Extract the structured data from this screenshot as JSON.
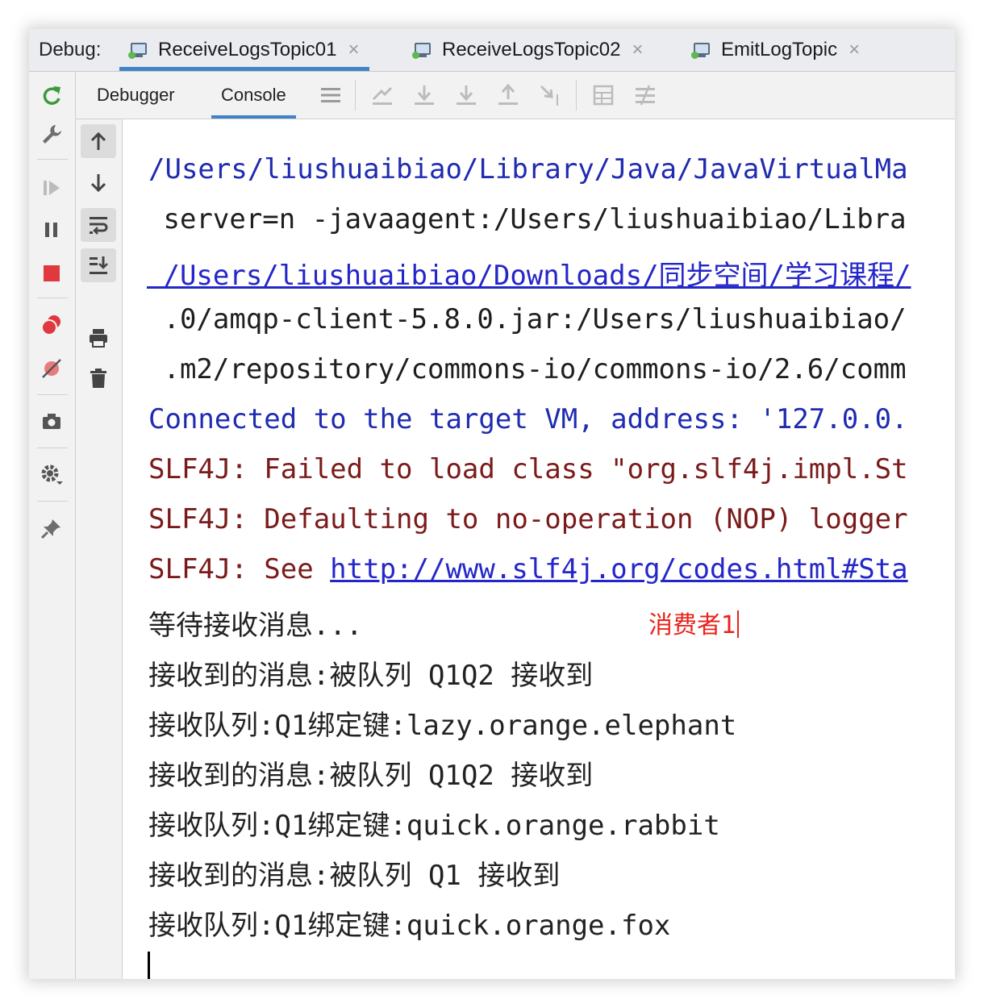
{
  "debug_label": "Debug:",
  "run_tabs": [
    {
      "label": "ReceiveLogsTopic01",
      "close": "×"
    },
    {
      "label": "ReceiveLogsTopic02",
      "close": "×"
    },
    {
      "label": "EmitLogTopic",
      "close": "×"
    }
  ],
  "sub_tabs": {
    "debugger": "Debugger",
    "console": "Console"
  },
  "console": {
    "lines": [
      "/Users/liushuaibiao/Library/Java/JavaVirtualMa",
      " server=n -javaagent:/Users/liushuaibiao/Libra",
      " /Users/liushuaibiao/Downloads/同步空间/学习课程/",
      " .0/amqp-client-5.8.0.jar:/Users/liushuaibiao/",
      " .m2/repository/commons-io/commons-io/2.6/comm",
      "Connected to the target VM, address: '127.0.0.",
      "SLF4J: Failed to load class \"org.slf4j.impl.St",
      "SLF4J: Defaulting to no-operation (NOP) logger",
      "SLF4J: See ",
      "等待接收消息...",
      "接收到的消息:被队列 Q1Q2 接收到",
      "接收队列:Q1绑定键:lazy.orange.elephant",
      "接收到的消息:被队列 Q1Q2 接收到",
      "接收队列:Q1绑定键:quick.orange.rabbit",
      "接收到的消息:被队列 Q1 接收到",
      "接收队列:Q1绑定键:quick.orange.fox"
    ],
    "slf4j_link": "http://www.slf4j.org/codes.html#Sta",
    "annotation": "消费者1"
  },
  "colors": {
    "output_blue": "#1f2bb0",
    "error_red": "#7b1a1a",
    "link": "#2426c9",
    "annotation": "#e8231b",
    "tab_underline": "#4083c9"
  }
}
